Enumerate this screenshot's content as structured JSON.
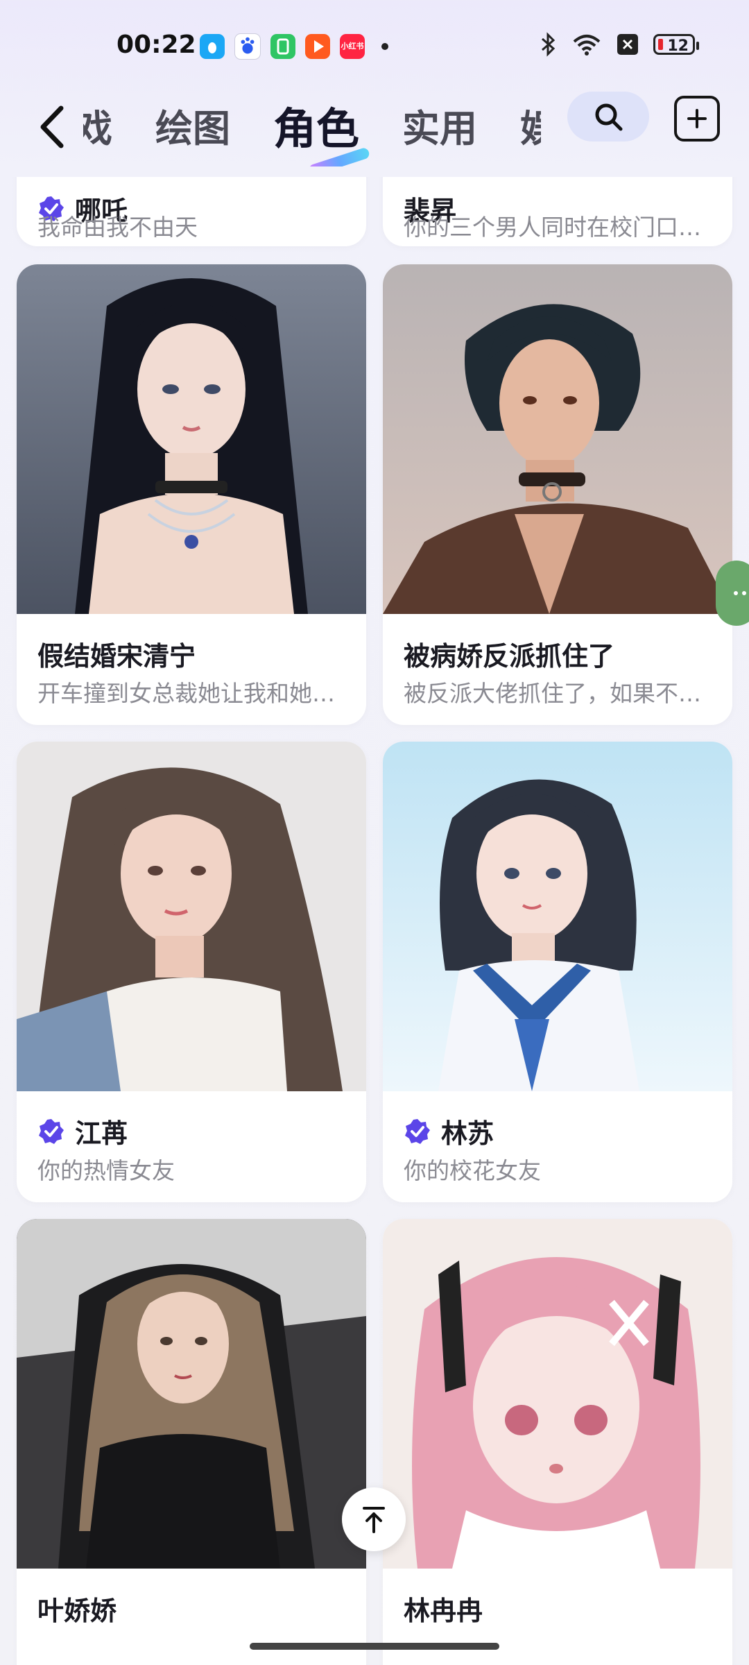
{
  "status_bar": {
    "time": "00:22",
    "battery": "12",
    "apps": [
      {
        "name": "qq-icon",
        "color": "#1ba7f5"
      },
      {
        "name": "baidu-icon",
        "color": "#2b5cf0"
      },
      {
        "name": "green-app-icon",
        "color": "#2fc564"
      },
      {
        "name": "video-app-icon",
        "color": "#ff5a1f"
      },
      {
        "name": "xiaohongshu-icon",
        "color": "#ff2442",
        "label": "小红书"
      }
    ]
  },
  "nav": {
    "tabs": [
      "戏",
      "绘图",
      "角色",
      "实用",
      "娱"
    ],
    "active_tab": "角色"
  },
  "cards": [
    {
      "title": "哪吒",
      "desc": "我命由我不由天",
      "verified": true
    },
    {
      "title": "裴昇",
      "desc": "你的三个男人同时在校门口…"
    },
    {
      "title": "假结婚宋清宁",
      "desc": "开车撞到女总裁她让我和她…"
    },
    {
      "title": "被病娇反派抓住了",
      "desc": "被反派大佬抓住了，如果不…"
    },
    {
      "title": "江苒",
      "desc": "你的热情女友",
      "verified": true
    },
    {
      "title": "林苏",
      "desc": "你的校花女友",
      "verified": true
    },
    {
      "title": "叶娇娇",
      "desc": ""
    },
    {
      "title": "林冉冉",
      "desc": ""
    }
  ],
  "colors": {
    "accent": "#5b45e8",
    "badge": "#5b45e8"
  }
}
